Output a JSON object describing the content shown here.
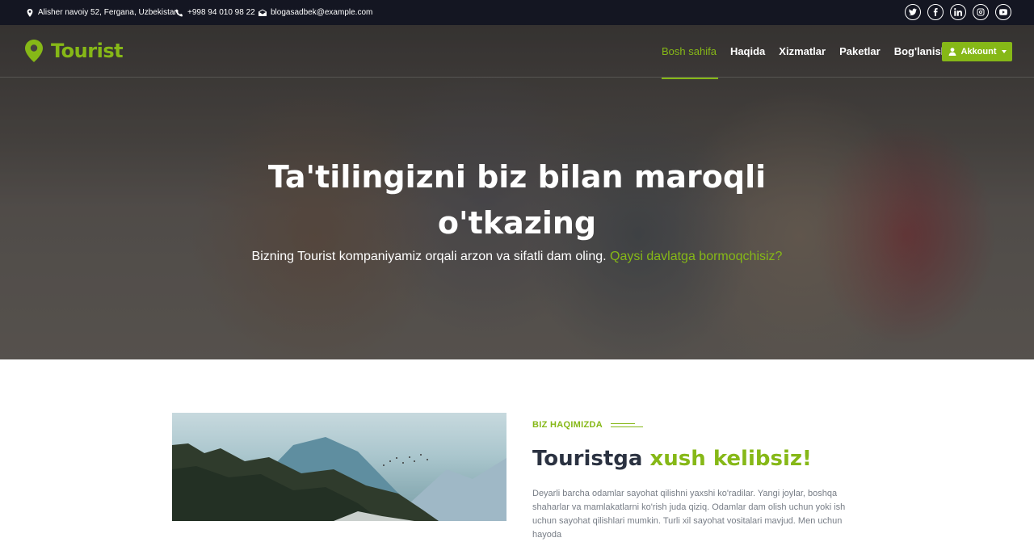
{
  "topbar": {
    "address": "Alisher navoiy 52, Fergana, Uzbekistan",
    "phone": "+998 94 010 98 22",
    "email": "blogasadbek@example.com",
    "socials": [
      "twitter-icon",
      "facebook-icon",
      "linkedin-icon",
      "instagram-icon",
      "youtube-icon"
    ]
  },
  "brand": {
    "name": "Tourist",
    "accent_color": "#86b817"
  },
  "nav": {
    "items": [
      {
        "label": "Bosh sahifa",
        "active": true
      },
      {
        "label": "Haqida"
      },
      {
        "label": "Xizmatlar"
      },
      {
        "label": "Paketlar"
      },
      {
        "label": "Bog'lanish"
      }
    ],
    "account_label": "Akkount"
  },
  "hero": {
    "title_line1": "Ta'tilingizni biz bilan maroqli",
    "title_line2": "o'tkazing",
    "subtitle": "Bizning Tourist kompaniyamiz orqali arzon va sifatli dam oling.",
    "subtitle_accent": "Qaysi davlatga bormoqchisiz?"
  },
  "about": {
    "tag": "BIZ HAQIMIZDA",
    "title_part1": "Touristga",
    "title_part2": "xush kelibsiz!",
    "text": "Deyarli barcha odamlar sayohat qilishni yaxshi ko'radilar. Yangi joylar, boshqa shaharlar va mamlakatlarni ko'rish juda qiziq. Odamlar dam olish uchun yoki ish uchun sayohat qilishlari mumkin. Turli xil sayohat vositalari mavjud. Men uchun hayoda"
  }
}
